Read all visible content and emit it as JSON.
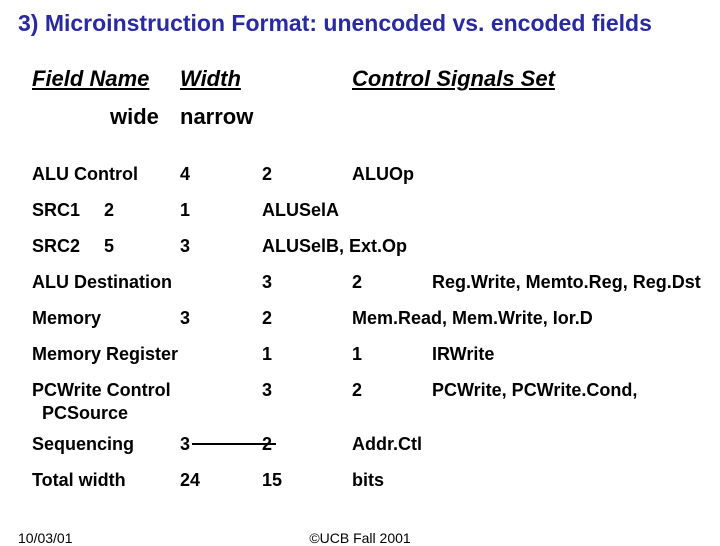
{
  "title": "3) Microinstruction Format: unencoded vs. encoded fields",
  "header": {
    "field_name": "Field Name",
    "width": "Width",
    "signals": "Control Signals Set",
    "wide": "wide",
    "narrow": "narrow"
  },
  "rows": {
    "alu_ctrl": {
      "name": "ALU Control",
      "wide": "4",
      "narrow": "2",
      "sig": "ALUOp"
    },
    "src1": {
      "name": "SRC1",
      "name2": "2",
      "wide": "1",
      "sig": "ALUSelA"
    },
    "src2": {
      "name": "SRC2",
      "name2": "5",
      "wide": "3",
      "sig": "ALUSelB, Ext.Op"
    },
    "alu_dst": {
      "name": "ALU Destination",
      "wide": "3",
      "narrow": "2",
      "sig": "Reg.Write, Memto.Reg, Reg.Dst"
    },
    "memory": {
      "name": "Memory",
      "wide": "3",
      "narrow": "2",
      "sig": "Mem.Read, Mem.Write, Ior.D"
    },
    "memreg": {
      "name": "Memory Register",
      "wide": "1",
      "narrow": "1",
      "sig": "IRWrite"
    },
    "pcwrite": {
      "name": "PCWrite Control\n  PCSource",
      "wide": "3",
      "narrow": "2",
      "sig": "PCWrite, PCWrite.Cond,"
    },
    "seq": {
      "name": "Sequencing",
      "wide": "3",
      "narrow": "2",
      "sig": "Addr.Ctl"
    },
    "total": {
      "name": "Total width",
      "wide": "24",
      "narrow": "15",
      "sig": "bits"
    }
  },
  "footer": {
    "date": "10/03/01",
    "copyright": "©UCB Fall 2001"
  },
  "chart_data": {
    "type": "table",
    "title": "Microinstruction Format: unencoded vs. encoded fields",
    "columns": [
      "Field Name",
      "Width (wide)",
      "Width (narrow)",
      "Control Signals Set"
    ],
    "rows": [
      [
        "ALU Control",
        4,
        2,
        "ALUOp"
      ],
      [
        "SRC1",
        2,
        1,
        "ALUSelA"
      ],
      [
        "SRC2",
        5,
        3,
        "ALUSelB, Ext.Op"
      ],
      [
        "ALU Destination",
        3,
        2,
        "Reg.Write, Memto.Reg, Reg.Dst"
      ],
      [
        "Memory",
        3,
        2,
        "Mem.Read, Mem.Write, Ior.D"
      ],
      [
        "Memory Register",
        1,
        1,
        "IRWrite"
      ],
      [
        "PCWrite Control PCSource",
        3,
        2,
        "PCWrite, PCWrite.Cond,"
      ],
      [
        "Sequencing",
        3,
        2,
        "Addr.Ctl"
      ],
      [
        "Total width",
        24,
        15,
        "bits"
      ]
    ]
  }
}
